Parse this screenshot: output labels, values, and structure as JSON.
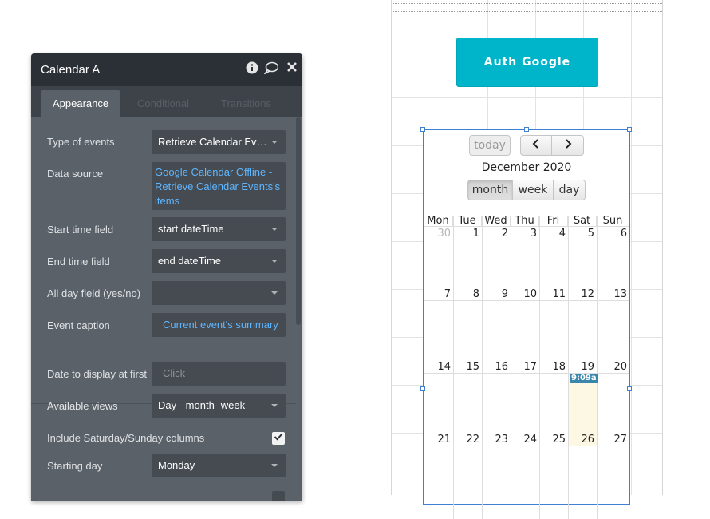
{
  "canvas": {
    "auth_button_label": "Auth Google",
    "calendar": {
      "today_label": "today",
      "prev_icon": "chevron-left-icon",
      "next_icon": "chevron-right-icon",
      "title": "December 2020",
      "views": [
        "month",
        "week",
        "day"
      ],
      "active_view": "month",
      "weekdays": [
        "Mon",
        "Tue",
        "Wed",
        "Thu",
        "Fri",
        "Sat",
        "Sun"
      ],
      "weeks": [
        [
          "30",
          "1",
          "2",
          "3",
          "4",
          "5",
          "6"
        ],
        [
          "7",
          "8",
          "9",
          "10",
          "11",
          "12",
          "13"
        ],
        [
          "14",
          "15",
          "16",
          "17",
          "18",
          "19",
          "20"
        ],
        [
          "21",
          "22",
          "23",
          "24",
          "25",
          "26",
          "27"
        ]
      ],
      "event": {
        "label": "9:09a"
      },
      "colors": {
        "selection_border": "#3f7fd4",
        "today_bg": "#fcf8e3",
        "event_bg": "#3a87ad"
      }
    }
  },
  "panel": {
    "title": "Calendar A",
    "header_icons": [
      "info-icon",
      "comment-icon",
      "close-icon"
    ],
    "tabs": [
      "Appearance",
      "Conditional",
      "Transitions"
    ],
    "active_tab": "Appearance",
    "properties": {
      "type_of_events": {
        "label": "Type of events",
        "value": "Retrieve Calendar Even..."
      },
      "data_source": {
        "label": "Data source",
        "value": "Google Calendar Offline - Retrieve Calendar Events's items"
      },
      "start_time_field": {
        "label": "Start time field",
        "value": "start dateTime"
      },
      "end_time_field": {
        "label": "End time field",
        "value": "end dateTime"
      },
      "all_day_field": {
        "label": "All day field (yes/no)",
        "value": ""
      },
      "event_caption": {
        "label": "Event caption",
        "value": "Current event's summary"
      },
      "date_to_display": {
        "label": "Date to display at first",
        "placeholder": "Click"
      },
      "available_views": {
        "label": "Available views",
        "value": "Day - month- week"
      },
      "include_weekend": {
        "label": "Include Saturday/Sunday columns",
        "checked": true
      },
      "starting_day": {
        "label": "Starting day",
        "value": "Monday"
      }
    },
    "colors": {
      "header_bg": "#2b3036",
      "body_bg": "#5b6168",
      "dynamic_text": "#5fb6ff"
    }
  }
}
